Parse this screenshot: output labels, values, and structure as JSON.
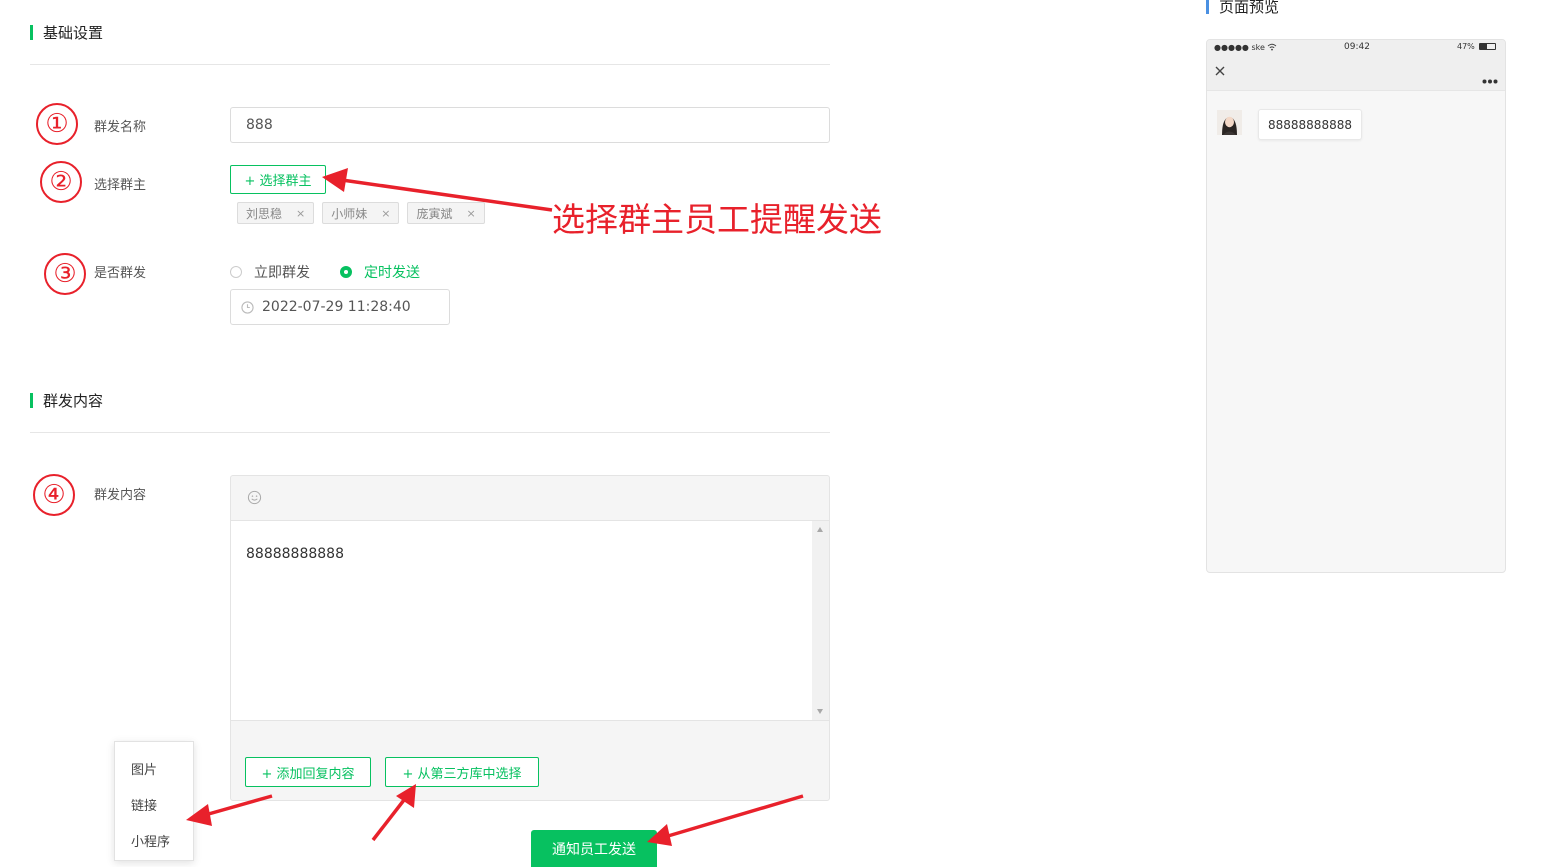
{
  "sections": {
    "basic_title": "基础设置",
    "content_title": "群发内容",
    "preview_title": "页面预览"
  },
  "form": {
    "name_label": "群发名称",
    "name_value": "888",
    "owner_label": "选择群主",
    "owner_button": "+ 选择群主",
    "tags": [
      "刘思稳",
      "小师妹",
      "庞寅斌"
    ],
    "tag_close": "×",
    "send_label": "是否群发",
    "send_options": [
      {
        "label": "立即群发",
        "selected": false
      },
      {
        "label": "定时发送",
        "selected": true
      }
    ],
    "datetime_value": "2022-07-29 11:28:40",
    "content_label": "群发内容",
    "content_text": "88888888888",
    "add_reply_button": "+ 添加回复内容",
    "third_party_button": "+ 从第三方库中选择",
    "submit_button": "通知员工发送"
  },
  "dropdown_menu": [
    "图片",
    "链接",
    "小程序"
  ],
  "annotations": {
    "steps": [
      "①",
      "②",
      "③",
      "④"
    ],
    "owner_note": "选择群主员工提醒发送",
    "color": "#e8212b"
  },
  "preview": {
    "signal": "●●●●● ske",
    "time": "09:42",
    "battery": "47%",
    "bubble_text": "88888888888"
  },
  "colors": {
    "accent": "#07c160",
    "preview_accent": "#4a90e2",
    "annotation": "#e8212b"
  },
  "icons": [
    "clock-icon",
    "emoji-icon",
    "close-icon",
    "more-icon",
    "wifi-icon",
    "battery-icon",
    "avatar"
  ]
}
